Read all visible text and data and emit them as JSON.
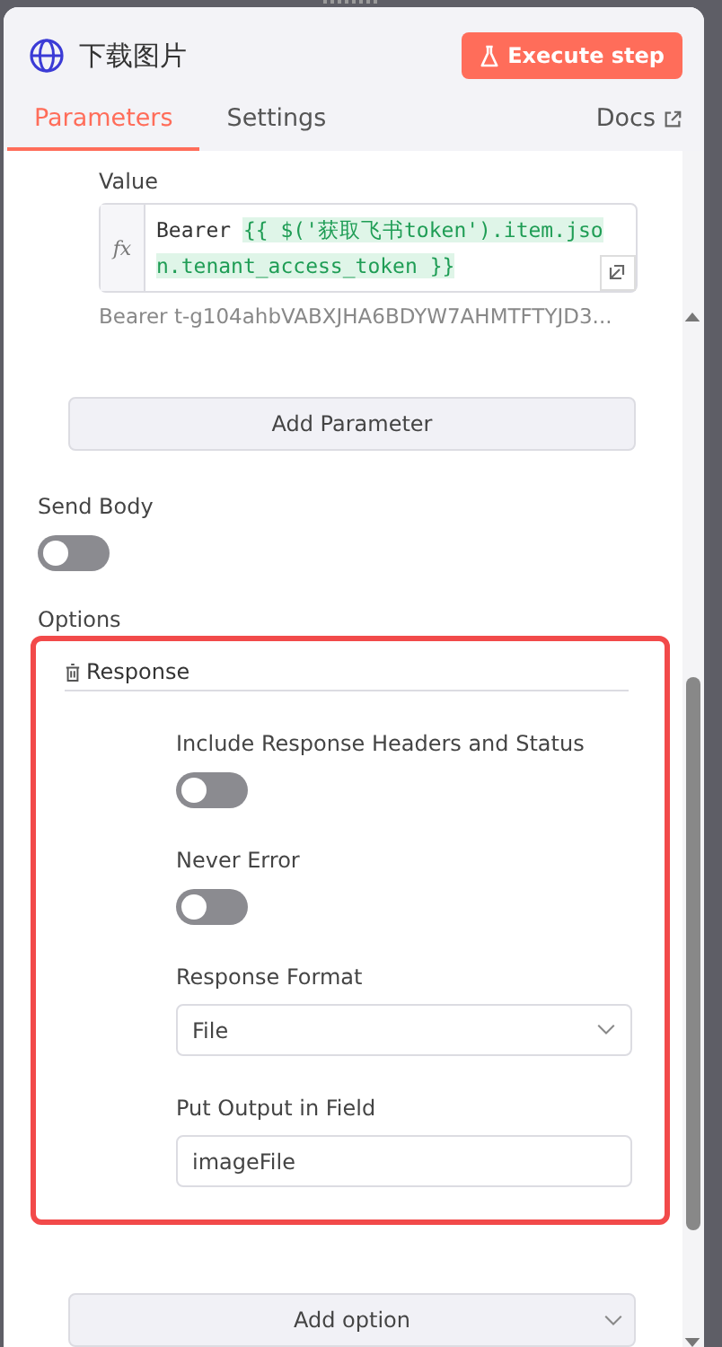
{
  "node": {
    "title": "下载图片",
    "execute_button": "Execute step"
  },
  "tabs": [
    {
      "label": "Parameters",
      "selected": true
    },
    {
      "label": "Settings",
      "selected": false
    }
  ],
  "docs_link": "Docs",
  "value_field": {
    "label": "Value",
    "fx_label": "fx",
    "prefix": "Bearer ",
    "expression": "{{ $('获取飞书token').item.json.tenant_access_token }}",
    "preview": "Bearer t-g104ahbVABXJHA6BDYW7AHMTFTYJD3..."
  },
  "add_parameter_button": "Add Parameter",
  "send_body": {
    "label": "Send Body",
    "on": false
  },
  "options": {
    "label": "Options",
    "highlighted": true,
    "group_title": "Response",
    "items": [
      {
        "kind": "toggle",
        "label": "Include Response Headers and Status",
        "on": false
      },
      {
        "kind": "toggle",
        "label": "Never Error",
        "on": false
      },
      {
        "kind": "select",
        "label": "Response Format",
        "value": "File"
      },
      {
        "kind": "input",
        "label": "Put Output in Field",
        "value": "imageFile"
      }
    ]
  },
  "add_option_button": "Add option"
}
